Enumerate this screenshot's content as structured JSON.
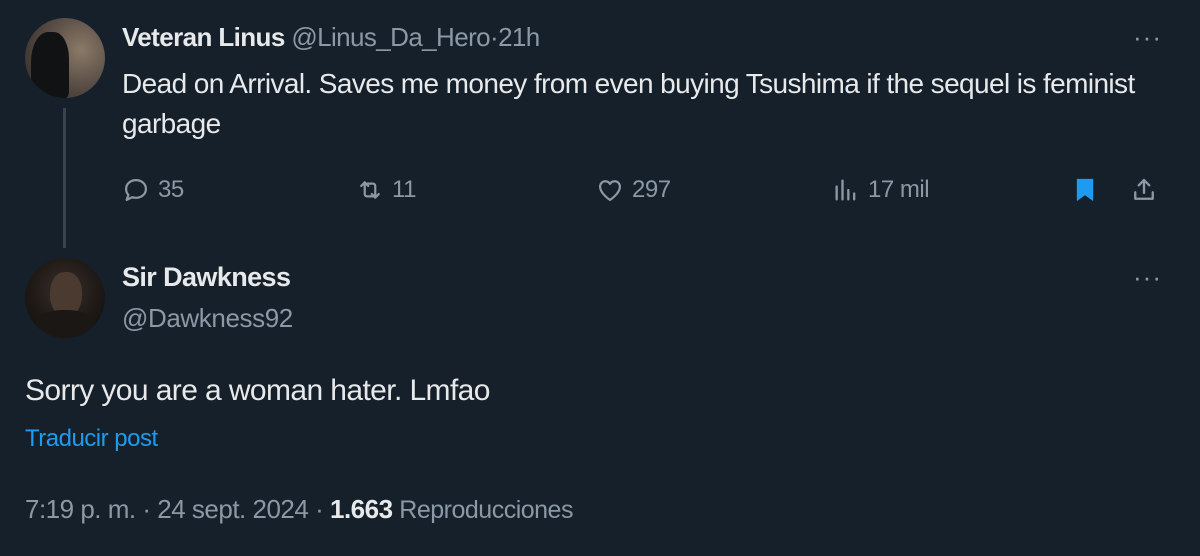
{
  "parent_tweet": {
    "display_name": "Veteran Linus",
    "handle": "@Linus_Da_Hero",
    "separator": "·",
    "time": "21h",
    "more": "···",
    "text": "Dead on Arrival.  Saves me money from even buying Tsushima if the sequel is feminist garbage",
    "actions": {
      "replies": "35",
      "retweets": "11",
      "likes": "297",
      "views": "17 mil"
    },
    "icons": {
      "reply": "comment-icon",
      "retweet": "retweet-icon",
      "like": "heart-icon",
      "views": "analytics-icon",
      "bookmark": "bookmark-icon",
      "share": "share-icon"
    }
  },
  "main_tweet": {
    "display_name": "Sir Dawkness",
    "handle": "@Dawkness92",
    "more": "···",
    "text": "Sorry you are a woman hater. Lmfao",
    "translate_label": "Traducir post",
    "time": "7:19 p. m.",
    "separator_1": "·",
    "date": "24 sept. 2024",
    "separator_2": "·",
    "views_count": "1.663",
    "views_label": "Reproducciones"
  },
  "colors": {
    "background": "#15202b",
    "primary_text": "#e7e9ea",
    "secondary_text": "#8b98a5",
    "accent": "#1d9bf0",
    "thread_line": "#38444d"
  }
}
